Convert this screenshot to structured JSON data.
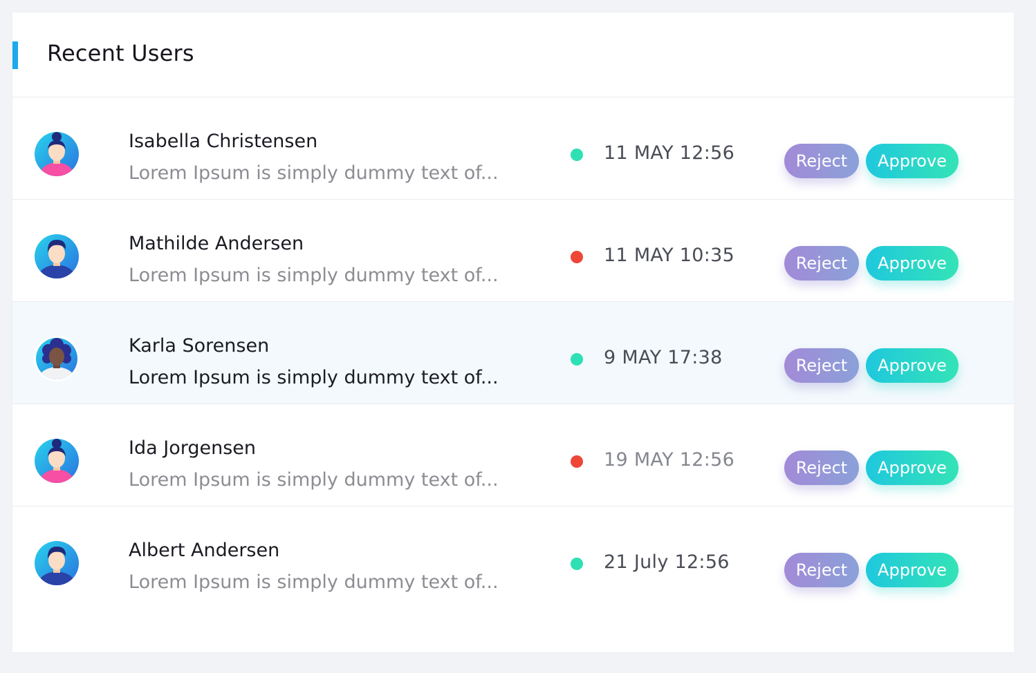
{
  "card": {
    "title": "Recent Users",
    "accent_color": "#1ea9ec"
  },
  "actions": {
    "reject_label": "Reject",
    "approve_label": "Approve"
  },
  "status_colors": {
    "online": "#2ee0b3",
    "offline": "#ee4638"
  },
  "users": [
    {
      "name": "Isabella Christensen",
      "description": "Lorem Ipsum is simply dummy text of...",
      "status": "online",
      "timestamp": "11 MAY 12:56",
      "avatar_icon": "female-bun-avatar-icon",
      "highlighted": false
    },
    {
      "name": "Mathilde Andersen",
      "description": "Lorem Ipsum is simply dummy text of...",
      "status": "offline",
      "timestamp": "11 MAY 10:35",
      "avatar_icon": "male-avatar-icon",
      "highlighted": false
    },
    {
      "name": "Karla Sorensen",
      "description": "Lorem Ipsum is simply dummy text of...",
      "status": "online",
      "timestamp": "9 MAY 17:38",
      "avatar_icon": "female-curly-avatar-icon",
      "highlighted": true
    },
    {
      "name": "Ida Jorgensen",
      "description": "Lorem Ipsum is simply dummy text of...",
      "status": "offline",
      "timestamp": "19 MAY 12:56",
      "avatar_icon": "female-bun-avatar-icon",
      "highlighted": false
    },
    {
      "name": "Albert Andersen",
      "description": "Lorem Ipsum is simply dummy text of...",
      "status": "online",
      "timestamp": "21 July 12:56",
      "avatar_icon": "male-avatar-icon",
      "highlighted": false
    }
  ]
}
